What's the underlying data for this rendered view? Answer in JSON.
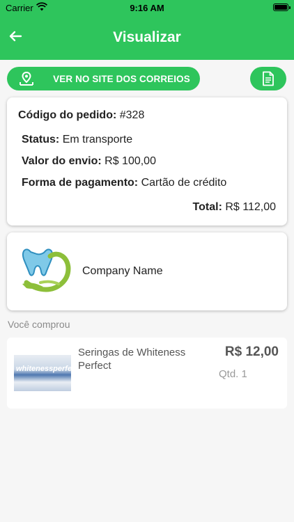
{
  "status_bar": {
    "carrier": "Carrier",
    "time": "9:16 AM"
  },
  "nav": {
    "title": "Visualizar",
    "back_icon": "arrow-left-icon"
  },
  "actions": {
    "correios_label": "VER NO SITE DOS CORREIOS",
    "correios_icon": "map-pin-icon",
    "doc_icon": "document-icon"
  },
  "order": {
    "code_label": "Código do pedido:",
    "code_value": "#328",
    "status_label": "Status:",
    "status_value": "Em transporte",
    "shipping_label": "Valor do envio:",
    "shipping_value": "R$ 100,00",
    "payment_label": "Forma de pagamento:",
    "payment_value": "Cartão de crédito",
    "total_label": "Total:",
    "total_value": "R$ 112,00"
  },
  "company": {
    "name": "Company Name"
  },
  "purchased": {
    "section_title": "Você comprou",
    "items": [
      {
        "name": "Seringas de Whiteness Perfect",
        "price": "R$ 12,00",
        "qty": "Qtd. 1",
        "thumb_text": "whitenessperfect"
      }
    ]
  },
  "colors": {
    "brand_green": "#2ec55c",
    "background": "#f6f6f6"
  }
}
